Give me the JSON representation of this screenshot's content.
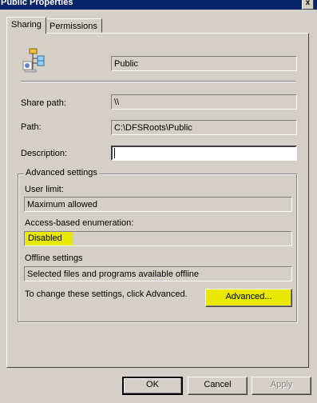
{
  "window": {
    "title": "Public Properties",
    "close_glyph": "x"
  },
  "tabs": [
    {
      "label": "Sharing",
      "active": true
    },
    {
      "label": "Permissions",
      "active": false
    }
  ],
  "share": {
    "icon": "shared-folder-icon",
    "name": "Public",
    "share_path_label": "Share path:",
    "share_path_value": "\\\\",
    "path_label": "Path:",
    "path_value": "C:\\DFSRoots\\Public",
    "description_label": "Description:",
    "description_value": ""
  },
  "advanced": {
    "group_title": "Advanced settings",
    "user_limit_label": "User limit:",
    "user_limit_value": "Maximum allowed",
    "abe_label": "Access-based enumeration:",
    "abe_value": "Disabled",
    "offline_label": "Offline settings",
    "offline_value": "Selected files and programs available offline",
    "hint": "To change these settings, click Advanced.",
    "advanced_button": "Advanced..."
  },
  "buttons": {
    "ok": "OK",
    "cancel": "Cancel",
    "apply": "Apply"
  },
  "colors": {
    "highlight": "#e8e800",
    "title_bar": "#0a246a",
    "dialog_face": "#d4d0c8"
  }
}
